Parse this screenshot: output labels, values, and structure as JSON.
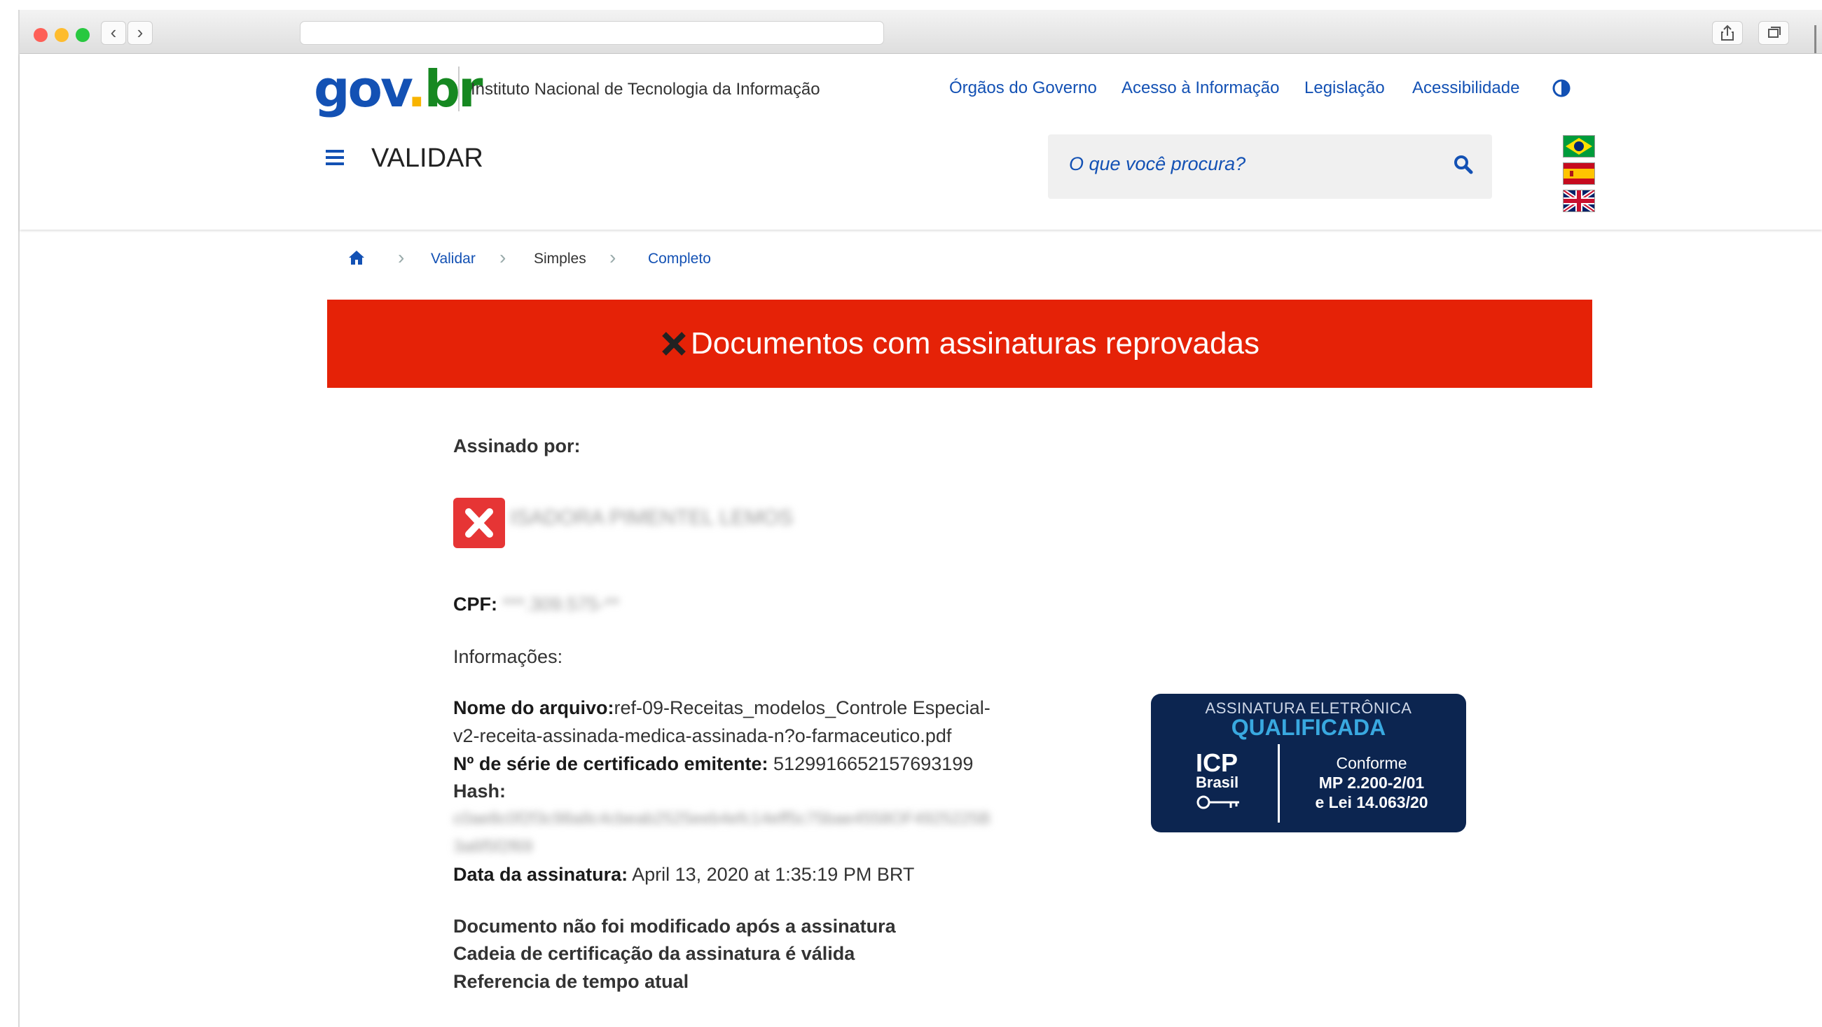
{
  "browser": {
    "url": ""
  },
  "header": {
    "logo": {
      "gov": "gov",
      "dot": ".",
      "br": "br"
    },
    "institution": "Instituto Nacional de Tecnologia da Informação",
    "nav": [
      "Órgãos do Governo",
      "Acesso à Informação",
      "Legislação",
      "Acessibilidade"
    ],
    "page_title": "VALIDAR",
    "search_placeholder": "O que você procura?",
    "languages": [
      "pt",
      "es",
      "en"
    ]
  },
  "breadcrumb": [
    "Validar",
    "Simples",
    "Completo"
  ],
  "alert": {
    "text": "Documentos com assinaturas reprovadas",
    "color": "#e52207"
  },
  "signature": {
    "signed_by_label": "Assinado por:",
    "signer_name": "ISADORA PIMENTEL LEMOS",
    "cpf_label": "CPF:",
    "cpf_value": "***.309.575-**",
    "info_label": "Informações:",
    "file_label": "Nome do arquivo:",
    "file_line1": "ref-09-Receitas_modelos_Controle Especial-",
    "file_line2": "v2-receita-assinada-medica-assinada-n?o-farmaceutico.pdf",
    "serial_label": "Nº de série de certificado emitente:",
    "serial_value": "5129916652157693199",
    "hash_label": "Hash:",
    "hash_line1": "c0ae8c0f2f3c98a8c4cbeab2525eeb4efc14eff5c75bae4558OF4925225B",
    "hash_line2": "3a6f5f2f69",
    "date_label": "Data da assinatura:",
    "date_value": "April 13, 2020 at 1:35:19 PM BRT",
    "checks": [
      "Documento não foi modificado após a assinatura",
      "Cadeia de certificação da assinatura é válida",
      "Referencia de tempo atual"
    ]
  },
  "seal": {
    "line1": "ASSINATURA ELETRÔNICA",
    "line2": "QUALIFICADA",
    "icp": "ICP",
    "brasil": "Brasil",
    "conforme": "Conforme",
    "mp": "MP 2.200-2/01",
    "lei": "e Lei 14.063/20"
  }
}
